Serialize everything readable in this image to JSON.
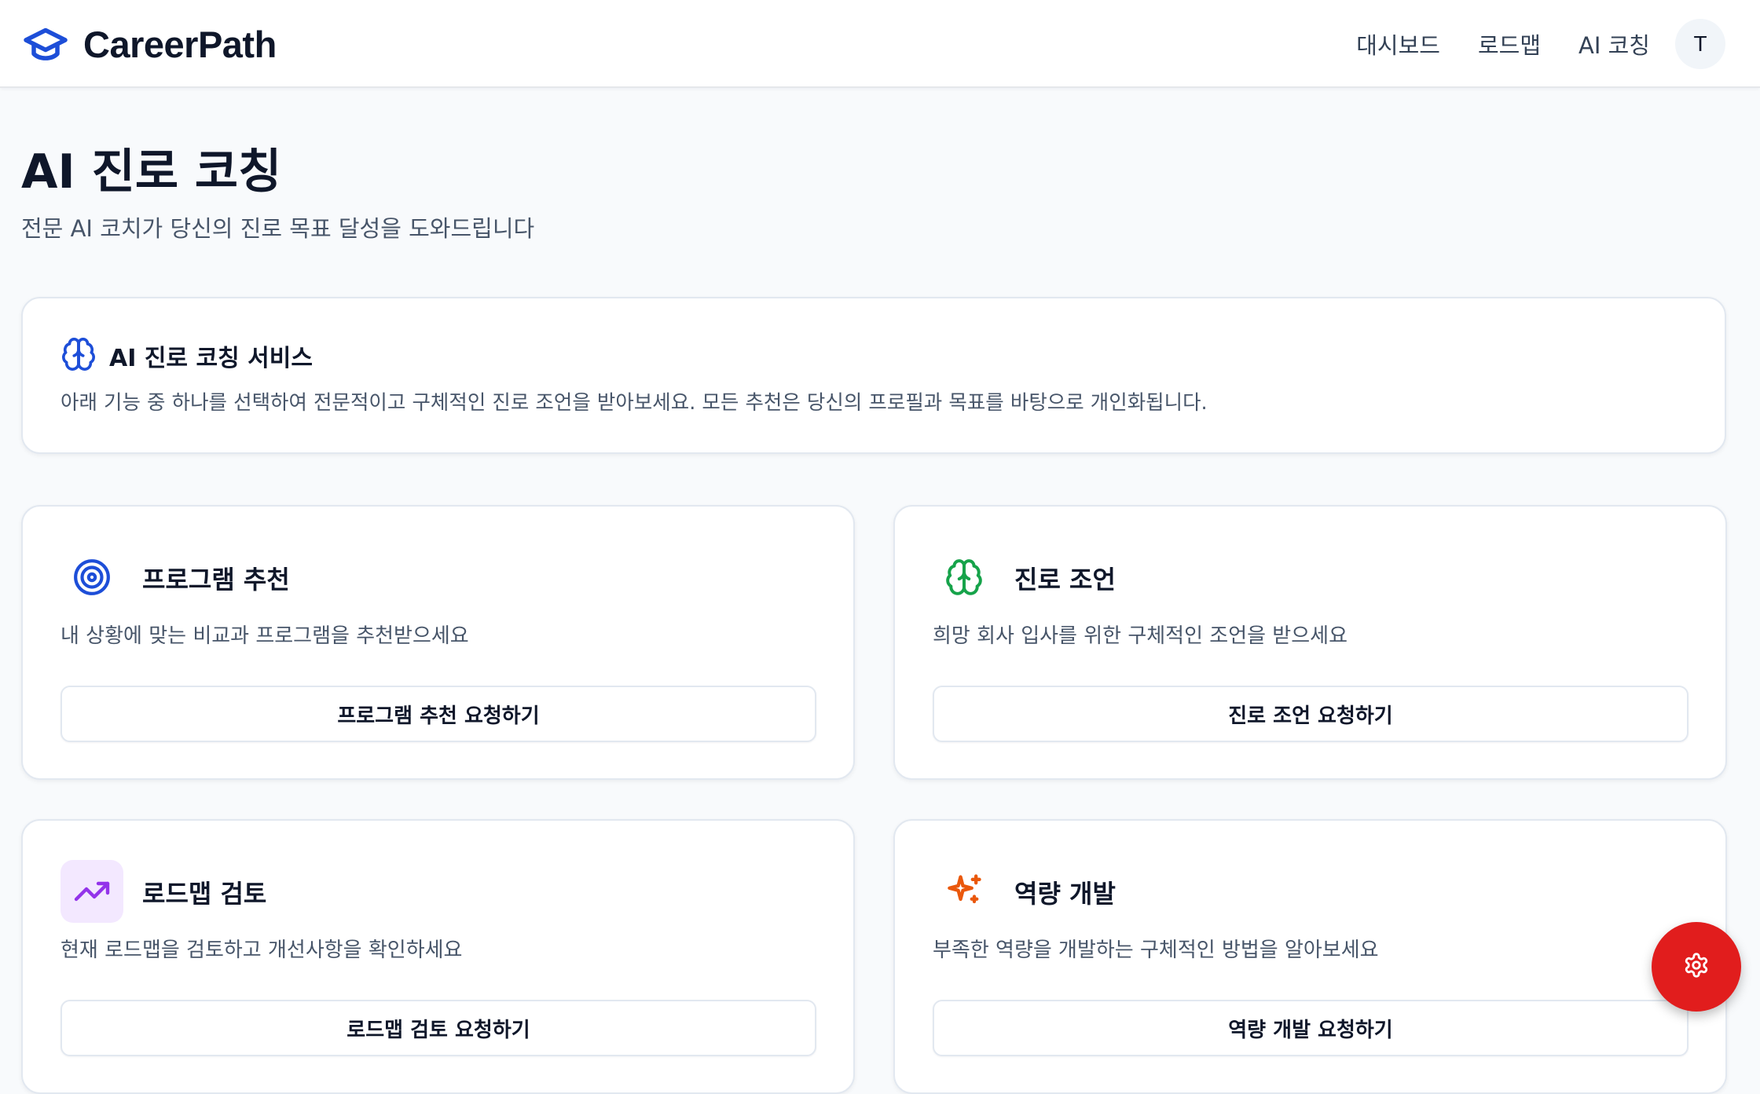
{
  "header": {
    "brand": "CareerPath",
    "nav": [
      "대시보드",
      "로드맵",
      "AI 코칭"
    ],
    "avatar_initial": "T"
  },
  "page": {
    "title": "AI 진로 코칭",
    "subtitle": "전문 AI 코치가 당신의 진로 목표 달성을 도와드립니다"
  },
  "info_card": {
    "title": "AI 진로 코칭 서비스",
    "description": "아래 기능 중 하나를 선택하여 전문적이고 구체적인 진로 조언을 받아보세요. 모든 추천은 당신의 프로필과 목표를 바탕으로 개인화됩니다."
  },
  "features": [
    {
      "icon": "target-icon",
      "color": "#1d4ed8",
      "title": "프로그램 추천",
      "description": "내 상황에 맞는 비교과 프로그램을 추천받으세요",
      "button": "프로그램 추천 요청하기"
    },
    {
      "icon": "brain-icon",
      "color": "#16a34a",
      "title": "진로 조언",
      "description": "희망 회사 입사를 위한 구체적인 조언을 받으세요",
      "button": "진로 조언 요청하기"
    },
    {
      "icon": "trending-up-icon",
      "color": "#9333ea",
      "title": "로드맵 검토",
      "description": "현재 로드맵을 검토하고 개선사항을 확인하세요",
      "button": "로드맵 검토 요청하기"
    },
    {
      "icon": "sparkles-icon",
      "color": "#ea580c",
      "title": "역량 개발",
      "description": "부족한 역량을 개발하는 구체적인 방법을 알아보세요",
      "button": "역량 개발 요청하기"
    }
  ],
  "colors": {
    "brand": "#1d4ed8",
    "fab": "#e11d1d"
  },
  "fab": {
    "icon": "settings-icon"
  }
}
